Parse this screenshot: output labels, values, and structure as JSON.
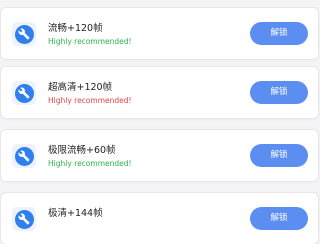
{
  "items": [
    {
      "title": "流畅+120帧",
      "subtitle": "Highly recommended!",
      "subtitle_color": "#2eb34a",
      "button_label": "解锁",
      "icon": "wrench-icon"
    },
    {
      "title": "超高清+120帧",
      "subtitle": "Highly recommended!",
      "subtitle_color": "#e64545",
      "button_label": "解锁",
      "icon": "wrench-icon"
    },
    {
      "title": "极限流畅+60帧",
      "subtitle": "Highly recommended!",
      "subtitle_color": "#2eb34a",
      "button_label": "解锁",
      "icon": "wrench-icon"
    },
    {
      "title": "极清+144帧",
      "subtitle": "",
      "subtitle_color": "#2eb34a",
      "button_label": "解锁",
      "icon": "wrench-icon"
    }
  ],
  "colors": {
    "accent": "#5b8ef0",
    "icon_blue": "#2f80ed",
    "background": "#f4f4f6"
  }
}
